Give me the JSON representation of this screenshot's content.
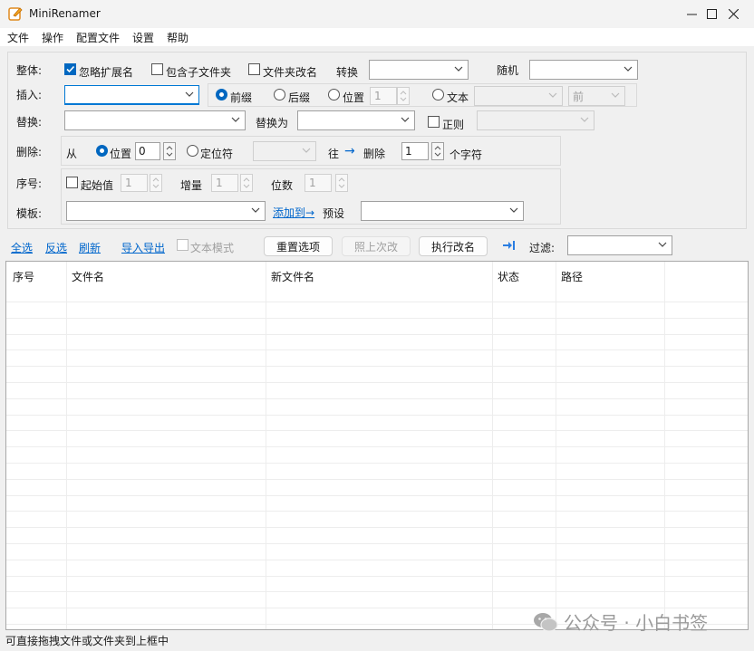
{
  "window": {
    "title": "MiniRenamer",
    "minimize": "—",
    "maximize": "☐",
    "close": "✕"
  },
  "menu": [
    "文件",
    "操作",
    "配置文件",
    "设置",
    "帮助"
  ],
  "overall": {
    "label": "整体:",
    "ignore_ext": "忽略扩展名",
    "include_subfolders": "包含子文件夹",
    "rename_folders": "文件夹改名",
    "convert_label": "转换",
    "random_label": "随机"
  },
  "insert": {
    "label": "插入:",
    "prefix": "前缀",
    "suffix": "后缀",
    "position": "位置",
    "position_value": "1",
    "text": "文本",
    "front": "前"
  },
  "replace": {
    "label": "替换:",
    "replace_with": "替换为",
    "regex": "正则"
  },
  "delete": {
    "label": "删除:",
    "from": "从",
    "position": "位置",
    "position_value": "0",
    "locator": "定位符",
    "to": "往",
    "arrow": "→",
    "delete_label": "删除",
    "count_value": "1",
    "chars": "个字符"
  },
  "sequence": {
    "label": "序号:",
    "start": "起始值",
    "start_value": "1",
    "step": "增量",
    "step_value": "1",
    "digits": "位数",
    "digits_value": "1"
  },
  "template": {
    "label": "模板:",
    "add_to": "添加到→",
    "preset": "预设"
  },
  "toolbar": {
    "select_all": "全选",
    "invert": "反选",
    "refresh": "刷新",
    "import_export": "导入导出",
    "text_mode": "文本模式",
    "reset": "重置选项",
    "same_as_last": "照上次改",
    "execute": "执行改名",
    "filter": "过滤:"
  },
  "table": {
    "columns": [
      "序号",
      "文件名",
      "新文件名",
      "状态",
      "路径"
    ]
  },
  "status": "可直接拖拽文件或文件夹到上框中",
  "watermark": "公众号 · 小白书签",
  "colors": {
    "accent": "#0067c0",
    "link": "#0066cc"
  }
}
